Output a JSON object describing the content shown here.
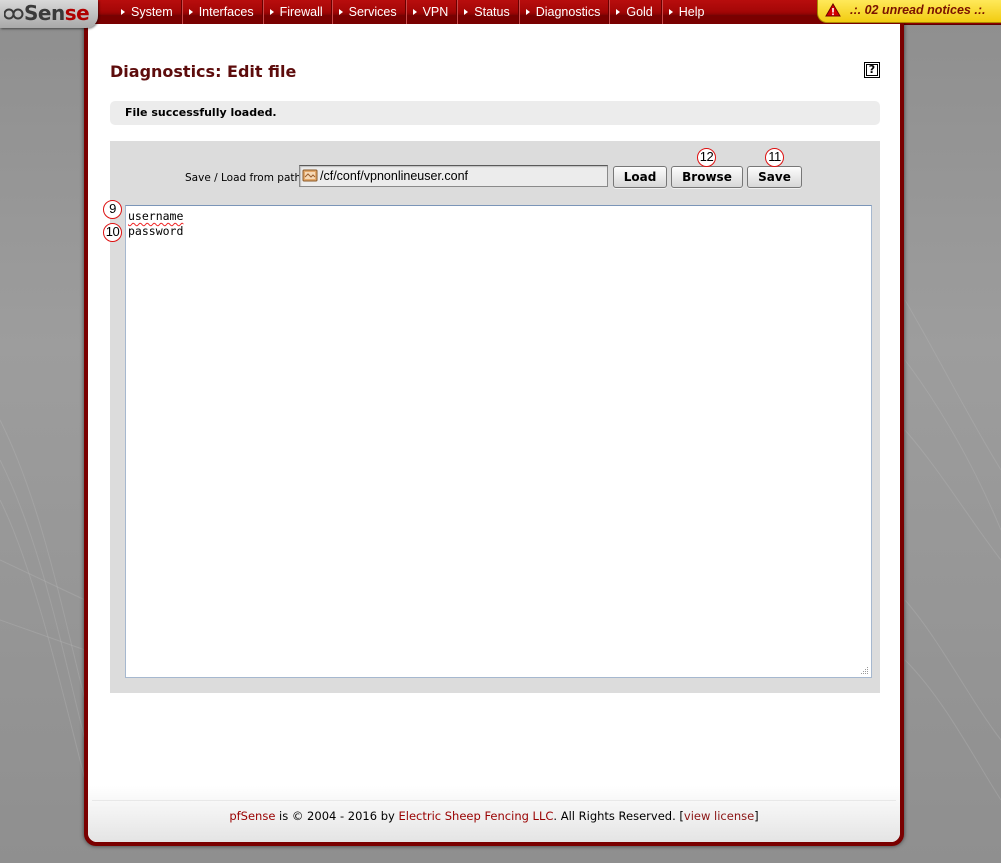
{
  "brand": {
    "logo_prefix": "pf",
    "logo_name_1": "Sen",
    "logo_name_2": "se"
  },
  "nav": {
    "items": [
      {
        "label": "System"
      },
      {
        "label": "Interfaces"
      },
      {
        "label": "Firewall"
      },
      {
        "label": "Services"
      },
      {
        "label": "VPN"
      },
      {
        "label": "Status"
      },
      {
        "label": "Diagnostics"
      },
      {
        "label": "Gold"
      },
      {
        "label": "Help"
      }
    ],
    "notices": ".:. 02 unread notices .:."
  },
  "page": {
    "title": "Diagnostics: Edit file",
    "help_label": "?",
    "message": "File successfully loaded."
  },
  "form": {
    "path_label": "Save / Load from path:",
    "path_value": "/cf/conf/vpnonlineuser.conf",
    "load_label": "Load",
    "browse_label": "Browse",
    "save_label": "Save"
  },
  "editor": {
    "lines": [
      "username",
      "password"
    ]
  },
  "markers": {
    "m9": "9",
    "m10": "10",
    "m11": "11",
    "m12": "12"
  },
  "footer": {
    "product": "pfSense",
    "text1": " is © 2004 - 2016 by ",
    "company": "Electric Sheep Fencing LLC",
    "text2": ". All Rights Reserved. [",
    "license_link": "view license",
    "text3": "]"
  },
  "colors": {
    "nav_red": "#a80000",
    "title_color": "#5d0c0c",
    "notice_yellow": "#f7d91f",
    "marker_red": "#dd1111"
  }
}
